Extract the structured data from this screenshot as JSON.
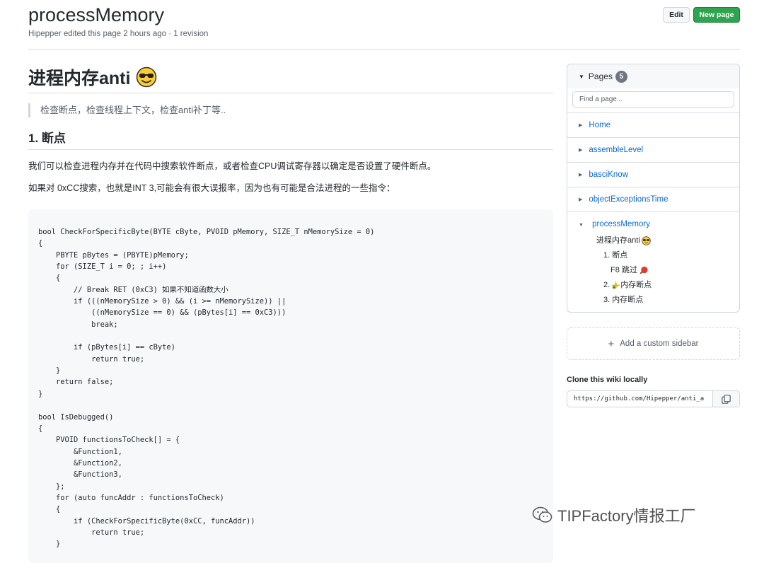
{
  "header": {
    "title": "processMemory",
    "meta": "Hipepper edited this page 2 hours ago · 1 revision",
    "edit_label": "Edit",
    "new_page_label": "New page"
  },
  "content": {
    "h1": "进程内存anti",
    "quote": "检查断点，检查线程上下文，检查anti补丁等..",
    "h2": "1. 断点",
    "p1": "我们可以检查进程内存并在代码中搜索软件断点，或者检查CPU调试寄存器以确定是否设置了硬件断点。",
    "p2": "如果对 0xCC搜索，也就是INT 3,可能会有很大误报率，因为也有可能是合法进程的一些指令：",
    "code": "bool CheckForSpecificByte(BYTE cByte, PVOID pMemory, SIZE_T nMemorySize = 0)\n{\n    PBYTE pBytes = (PBYTE)pMemory;\n    for (SIZE_T i = 0; ; i++)\n    {\n        // Break RET (0xC3) 如果不知道函数大小\n        if (((nMemorySize > 0) && (i >= nMemorySize)) ||\n            ((nMemorySize == 0) && (pBytes[i] == 0xC3)))\n            break;\n\n        if (pBytes[i] == cByte)\n            return true;\n    }\n    return false;\n}\n\nbool IsDebugged()\n{\n    PVOID functionsToCheck[] = {\n        &Function1,\n        &Function2,\n        &Function3,\n    };\n    for (auto funcAddr : functionsToCheck)\n    {\n        if (CheckForSpecificByte(0xCC, funcAddr))\n            return true;\n    }"
  },
  "sidebar": {
    "pages_label": "Pages",
    "pages_count": "5",
    "search_placeholder": "Find a page...",
    "items": [
      {
        "label": "Home"
      },
      {
        "label": "assembleLevel"
      },
      {
        "label": "basciKnow"
      },
      {
        "label": "objectExceptionsTime"
      }
    ],
    "current": {
      "label": "processMemory",
      "toc": [
        "进程内存anti",
        "1. 断点",
        "F8 跳过",
        "2.",
        "内存断点",
        "3. 内存断点"
      ]
    },
    "custom_sidebar_label": "Add a custom sidebar",
    "clone_title": "Clone this wiki locally",
    "clone_url": "https://github.com/Hipepper/anti_a"
  },
  "icons": {
    "caret": "caret-down-icon",
    "copy": "copy-icon",
    "plus": "plus-icon",
    "wechat": "wechat-icon"
  },
  "watermark": "TIPFactory情报工厂"
}
